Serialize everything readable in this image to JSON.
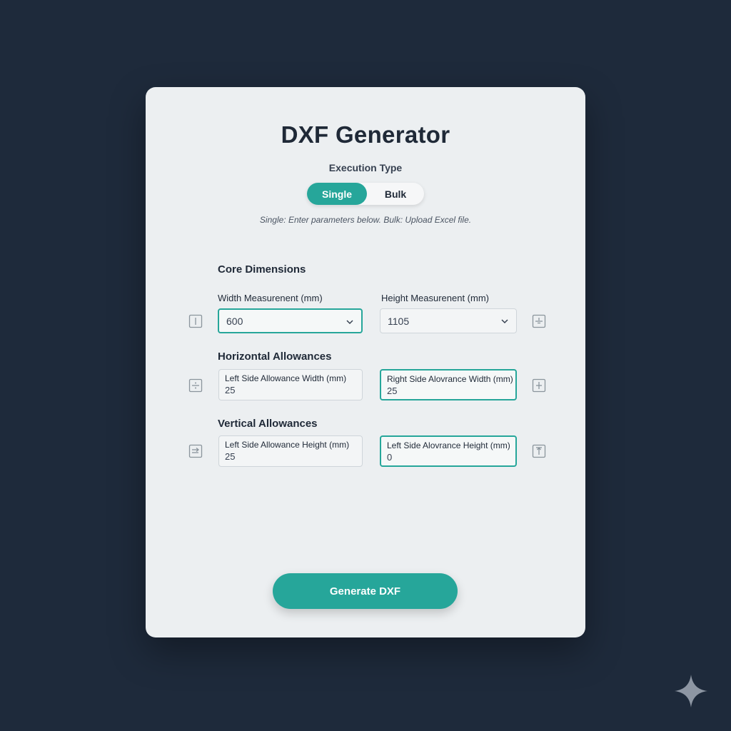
{
  "app": {
    "title": "DXF Generator"
  },
  "execution": {
    "label": "Execution Type",
    "options": [
      "Single",
      "Bulk"
    ],
    "selected": "Single",
    "hint": "Single: Enter parameters below. Bulk: Upload Excel file."
  },
  "core": {
    "title": "Core Dimensions",
    "width": {
      "label": "Width Measurenent (mm)",
      "value": "600"
    },
    "height": {
      "label": "Height Measurenent (mm)",
      "value": "1105"
    }
  },
  "horizontal": {
    "title": "Horizontal Allowances",
    "left": {
      "label": "Left Side Allowance Width (mm)",
      "value": "25"
    },
    "right": {
      "label": "Right Side Alovrance Width (mm)",
      "value": "25"
    }
  },
  "vertical": {
    "title": "Vertical Allowances",
    "left": {
      "label": "Left Side Allowance Height (mm)",
      "value": "25"
    },
    "right": {
      "label": "Left Side Alovrance Height (mm)",
      "value": "0"
    }
  },
  "actions": {
    "generate_label": "Generate DXF"
  },
  "colors": {
    "accent": "#26a69a",
    "background": "#1e2a3b",
    "card": "#eceff1",
    "text": "#1f2937"
  },
  "icons": {
    "width": "width-ruler-icon",
    "height": "height-split-icon",
    "left_allowance": "divide-icon",
    "right_allowance": "plus-icon",
    "vertical_left": "arrow-right-box-icon",
    "vertical_right": "arrow-up-box-icon",
    "select": "chevron-down-icon",
    "watermark": "sparkle-icon"
  }
}
